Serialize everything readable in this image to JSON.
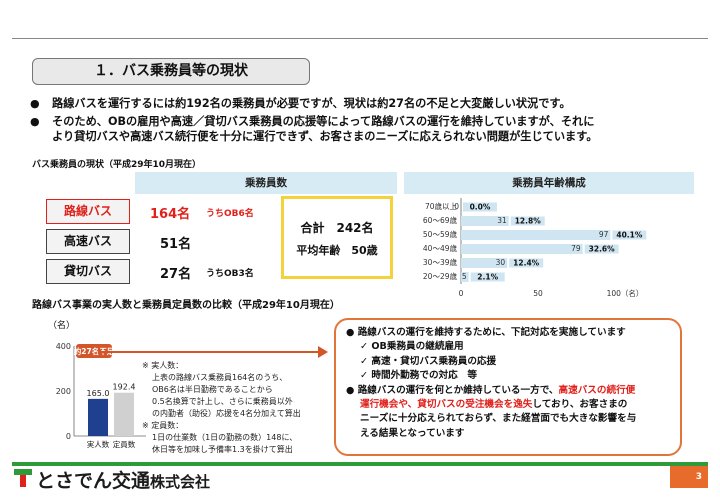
{
  "title": "１．バス乗務員等の現状",
  "bullets": [
    "路線バスを運行するには約192名の乗務員が必要ですが、現状は約27名の不足と大変厳しい状況です。",
    "そのため、OBの雇用や高速／貸切バス乗務員の応援等によって路線バスの運行を維持していますが、それに",
    "より貸切バスや高速バス続行便を十分に運行できず、お客さまのニーズに応えられない問題が生じています。"
  ],
  "bullet_glyph": "●",
  "staff_section_title": "バス乗務員の現状（平成29年10月現在）",
  "staff_header": "乗務員数",
  "age_header": "乗務員年齢構成",
  "staff_rows": [
    {
      "label": "路線バス",
      "value": "164名",
      "note": "うちOB6名",
      "highlight": true
    },
    {
      "label": "高速バス",
      "value": "51名",
      "note": ""
    },
    {
      "label": "貸切バス",
      "value": "27名",
      "note": "うちOB3名"
    }
  ],
  "total": {
    "line1": "合計　242名",
    "line2": "平均年齢　50歳"
  },
  "age_chart": {
    "type": "bar",
    "orientation": "horizontal",
    "categories": [
      "70歳以上",
      "60～69歳",
      "50～59歳",
      "40～49歳",
      "30～39歳",
      "20～29歳"
    ],
    "values": [
      0,
      31,
      97,
      79,
      30,
      5
    ],
    "percent_labels": [
      "0.0%",
      "12.8%",
      "40.1%",
      "32.6%",
      "12.4%",
      "2.1%"
    ],
    "value_labels": [
      "0",
      "31",
      "97",
      "79",
      "30",
      "5"
    ],
    "xlim": [
      0,
      100
    ],
    "xticks": [
      "0",
      "50",
      "100（名）"
    ],
    "color": "#cfe6f2"
  },
  "compare_title": "路線バス事業の実人数と乗務員定員数の比較（平成29年10月現在）",
  "compare_unit": "（名）",
  "compare_chart": {
    "type": "bar",
    "categories": [
      "実人数",
      "定員数"
    ],
    "values": [
      165.0,
      192.4
    ],
    "value_labels": [
      "165.0",
      "192.4"
    ],
    "ylim": [
      0,
      400
    ],
    "yticks": [
      "0",
      "200",
      "400"
    ],
    "colors": [
      "#1f3f8f",
      "#d0d0d0"
    ],
    "callout": "約27名不足",
    "callout_color": "#d2562a"
  },
  "notes": [
    "※ 実人数：",
    "上表の路線バス乗務員164名のうち、",
    "OB6名は半日勤務であることから",
    "0.5名換算で計上し、さらに乗務員以外",
    "の内勤者（助役）応援を4名分加えて算出",
    "※ 定員数：",
    "1日の仕業数（1日の勤務の数）148に、",
    "休日等を加味し予備率1.3を掛けて算出"
  ],
  "actions": {
    "intro": "● 路線バスの運行を維持するために、下記対応を実施しています",
    "items": [
      "✓ OB乗務員の継続雇用",
      "✓ 高速・貸切バス乗務員の応援",
      "✓ 時間外勤務での対応　等"
    ],
    "p2_a": "● 路線バスの運行を何とか維持している一方で、",
    "p2_b": "高速バスの続行便",
    "p2_c": "運行機会や、貸切バスの受注機会を逸失",
    "p2_d": "しており、お客さまの",
    "p2_e": "ニーズに十分応えられておらず、また経営面でも大きな影響を与",
    "p2_f": "える結果となっています"
  },
  "footer": {
    "logo_text_big": "とさでん交通",
    "logo_text_small": "株式会社",
    "page": "3"
  }
}
